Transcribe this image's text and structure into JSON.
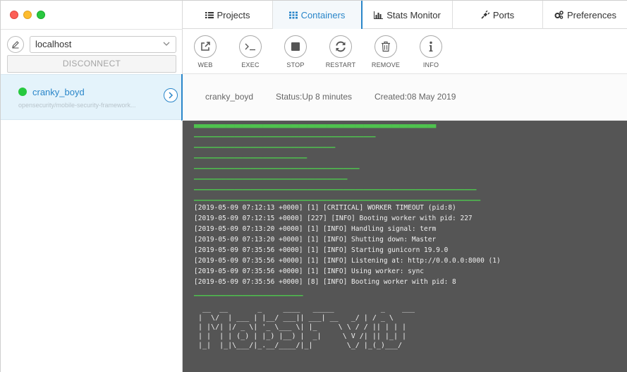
{
  "window": {
    "controls": [
      "close",
      "minimize",
      "maximize"
    ]
  },
  "colors": {
    "accent": "#2a86c9",
    "running": "#27c93f",
    "log_bg": "#555555",
    "log_green": "#4ec24e"
  },
  "sidebar": {
    "edit_icon": "pencil-icon",
    "host_select": {
      "value": "localhost"
    },
    "disconnect_label": "DISCONNECT",
    "containers": [
      {
        "name": "cranky_boyd",
        "image": "opensecurity/mobile-security-framework...",
        "status": "running"
      }
    ]
  },
  "nav": {
    "tabs": [
      {
        "label": "Projects",
        "icon": "list-icon"
      },
      {
        "label": "Containers",
        "icon": "grid-icon",
        "active": true
      },
      {
        "label": "Stats Monitor",
        "icon": "bar-chart-icon"
      },
      {
        "label": "Ports",
        "icon": "plug-icon"
      },
      {
        "label": "Preferences",
        "icon": "gears-icon"
      }
    ]
  },
  "toolbar": {
    "web": "WEB",
    "exec": "EXEC",
    "stop": "STOP",
    "restart": "RESTART",
    "remove": "REMOVE",
    "info": "INFO"
  },
  "details": {
    "name": "cranky_boyd",
    "status": "Status:Up 8 minutes",
    "created": "Created:08 May 2019"
  },
  "log": {
    "lines": [
      "[2019-05-09 07:12:13 +0000] [1] [CRITICAL] WORKER TIMEOUT (pid:8)",
      "[2019-05-09 07:12:15 +0000] [227] [INFO] Booting worker with pid: 227",
      "[2019-05-09 07:13:20 +0000] [1] [INFO] Handling signal: term",
      "[2019-05-09 07:13:20 +0000] [1] [INFO] Shutting down: Master",
      "[2019-05-09 07:35:56 +0000] [1] [INFO] Starting gunicorn 19.9.0",
      "[2019-05-09 07:35:56 +0000] [1] [INFO] Listening at: http://0.0.0.0:8000 (1)",
      "[2019-05-09 07:35:56 +0000] [1] [INFO] Using worker: sync",
      "[2019-05-09 07:35:56 +0000] [8] [INFO] Booting worker with pid: 8"
    ],
    "ascii_art": [
      " __  __       _     ____   _____           _    ___  ",
      "|  \\/  | ___ | |__/ ___|| ___| __   _/ | / _ \\ ",
      "| |\\/| |/ _ \\| '_ \\___ \\| |_     \\ \\ / / || | | |",
      "| |  | | (_) | |_) |__) |  _|     \\ V /| || |_| |",
      "|_|  |_|\\___/|_.__/____/|_|        \\_/ |_(_)___/ "
    ]
  }
}
